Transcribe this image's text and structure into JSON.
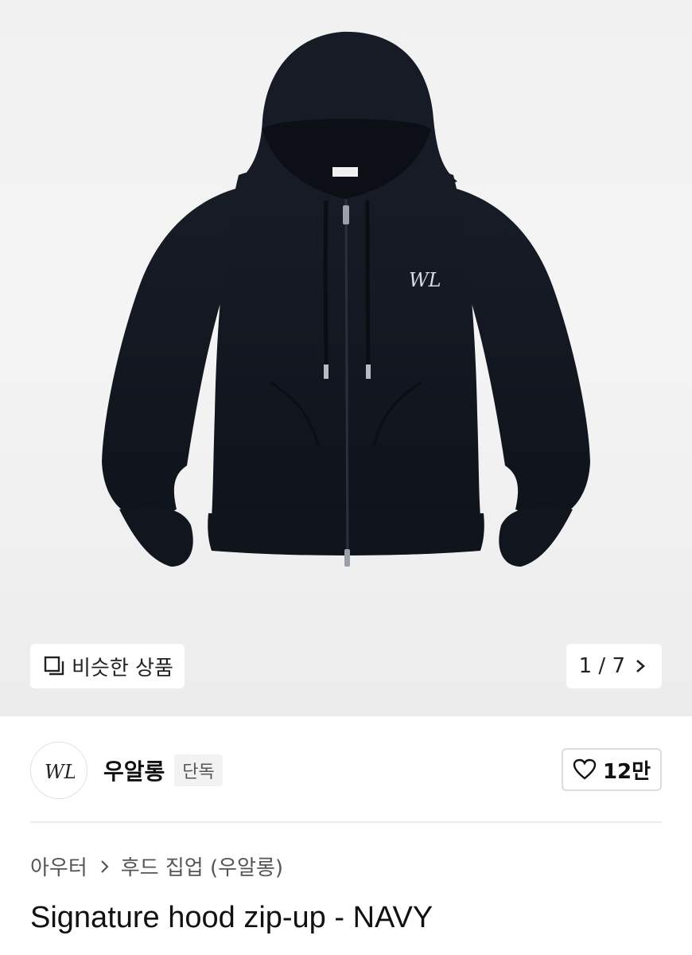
{
  "gallery": {
    "similar_label": "비슷한 상품",
    "pager_text": "1 / 7",
    "similar_icon": "copy-icon",
    "pager_icon": "chevron-right-icon"
  },
  "brand": {
    "name": "우알롱",
    "badge": "단독",
    "logo_text": "WL",
    "like_count": "12만",
    "like_icon": "heart-icon"
  },
  "breadcrumb": {
    "items": [
      "아우터",
      "후드 집업 (우알롱)"
    ],
    "separator_icon": "chevron-right-icon"
  },
  "product": {
    "title": "Signature hood zip-up - NAVY",
    "color_name": "NAVY",
    "garment_color": "#131822"
  }
}
